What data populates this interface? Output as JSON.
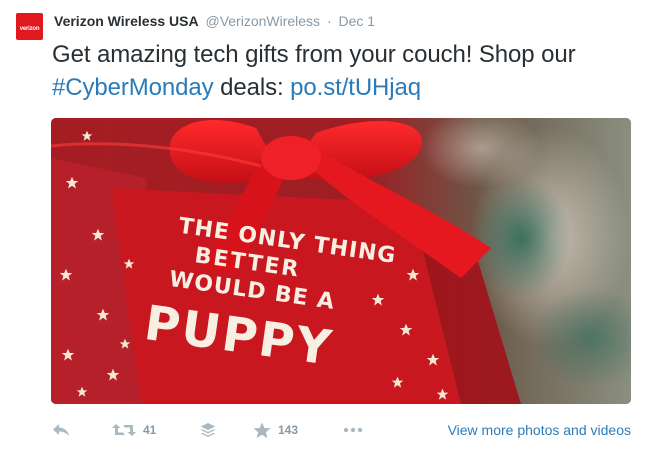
{
  "tweet": {
    "display_name": "Verizon Wireless USA",
    "handle": "@VerizonWireless",
    "separator": "·",
    "date": "Dec 1",
    "text_before": "Get amazing tech gifts from your couch! Shop our ",
    "hashtag": "#CyberMonday",
    "text_middle": " deals: ",
    "link": "po.st/tUHjaq"
  },
  "avatar": {
    "logo_text": "verizon",
    "brand_color": "#e1181e"
  },
  "media": {
    "tag_lines": [
      "THE ONLY THING",
      "BETTER",
      "WOULD BE A",
      "PUPPY"
    ],
    "ribbon_color": "#e0141c",
    "tag_color": "#c8171f"
  },
  "actions": {
    "reply_icon": "reply-icon",
    "retweet_icon": "retweet-icon",
    "retweet_count": "41",
    "buffer_icon": "buffer-stack-icon",
    "favorite_icon": "star-icon",
    "favorite_count": "143",
    "more_icon": "more-dots-icon",
    "view_more_label": "View more photos and videos",
    "icon_color": "#aab8c2",
    "link_color": "#2b7bb9"
  }
}
